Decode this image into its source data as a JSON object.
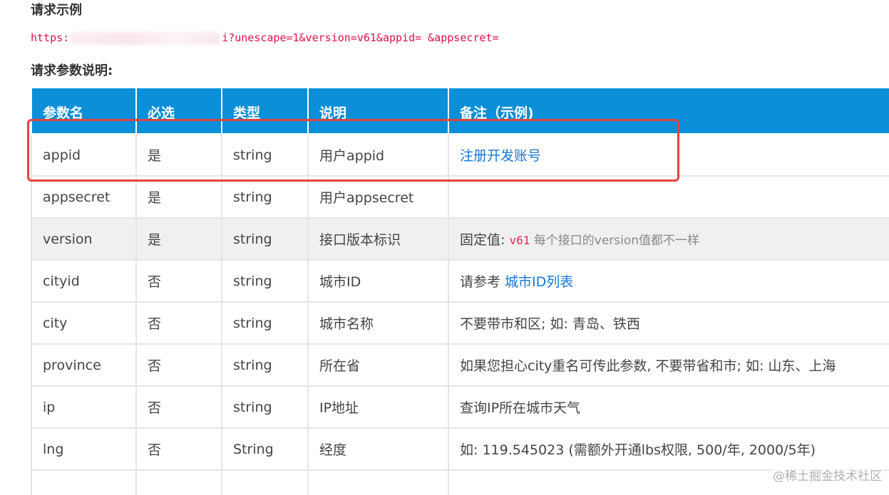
{
  "section_example": {
    "title": "请求示例"
  },
  "url": {
    "prefix": "https:",
    "suffix": "i?unescape=1&version=v61&appid= &appsecret="
  },
  "section_params": {
    "title": "请求参数说明:"
  },
  "table": {
    "headers": [
      "参数名",
      "必选",
      "类型",
      "说明",
      "备注（示例)"
    ],
    "rows": [
      {
        "name": "appid",
        "required": "是",
        "type": "string",
        "desc": "用户appid",
        "note_link": "注册开发账号"
      },
      {
        "name": "appsecret",
        "required": "是",
        "type": "string",
        "desc": "用户appsecret"
      },
      {
        "name": "version",
        "required": "是",
        "type": "string",
        "desc": "接口版本标识",
        "note_prefix": "固定值: ",
        "note_code": "v61",
        "note_muted": " 每个接口的version值都不一样"
      },
      {
        "name": "cityid",
        "required": "否",
        "type": "string",
        "desc": "城市ID",
        "note_prefix": "请参考 ",
        "note_link": "城市ID列表"
      },
      {
        "name": "city",
        "required": "否",
        "type": "string",
        "desc": "城市名称",
        "note": "不要带市和区; 如: 青岛、铁西"
      },
      {
        "name": "province",
        "required": "否",
        "type": "string",
        "desc": "所在省",
        "note": "如果您担心city重名可传此参数, 不要带省和市; 如: 山东、上海"
      },
      {
        "name": "ip",
        "required": "否",
        "type": "string",
        "desc": "IP地址",
        "note": "查询IP所在城市天气"
      },
      {
        "name": "lng",
        "required": "否",
        "type": "String",
        "desc": "经度",
        "note": "如: 119.545023 (需额外开通lbs权限, 500/年, 2000/5年)"
      }
    ]
  },
  "watermark": "@稀土掘金技术社区",
  "colors": {
    "header_bg": "#0a8fd8",
    "highlight_border": "#e8413e",
    "link": "#1677d9",
    "url_text": "#dd1144"
  }
}
